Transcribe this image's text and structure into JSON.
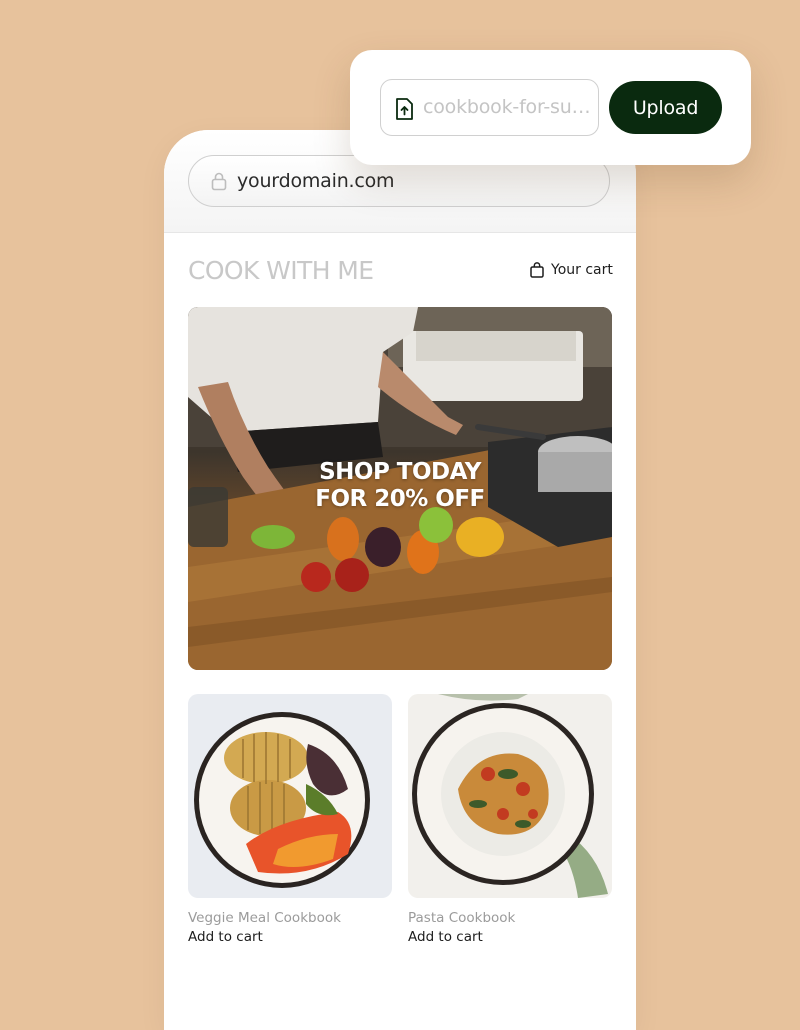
{
  "browser": {
    "url": "yourdomain.com"
  },
  "store": {
    "brand": "COOK WITH ME",
    "cart_label": "Your cart"
  },
  "hero": {
    "line1": "SHOP TODAY",
    "line2": "FOR 20% OFF"
  },
  "products": [
    {
      "name": "Veggie Meal Cookbook",
      "action": "Add to cart"
    },
    {
      "name": "Pasta Cookbook",
      "action": "Add to cart"
    }
  ],
  "upload": {
    "file_name": "cookbook-for-summer.pdf",
    "button_label": "Upload"
  },
  "colors": {
    "background": "#e7c29c",
    "upload_button": "#0a2a0f",
    "brand_text": "#c8c8c8"
  },
  "icons": {
    "url_bar": "lock-icon",
    "cart": "shopping-bag-icon",
    "file": "file-upload-icon"
  }
}
